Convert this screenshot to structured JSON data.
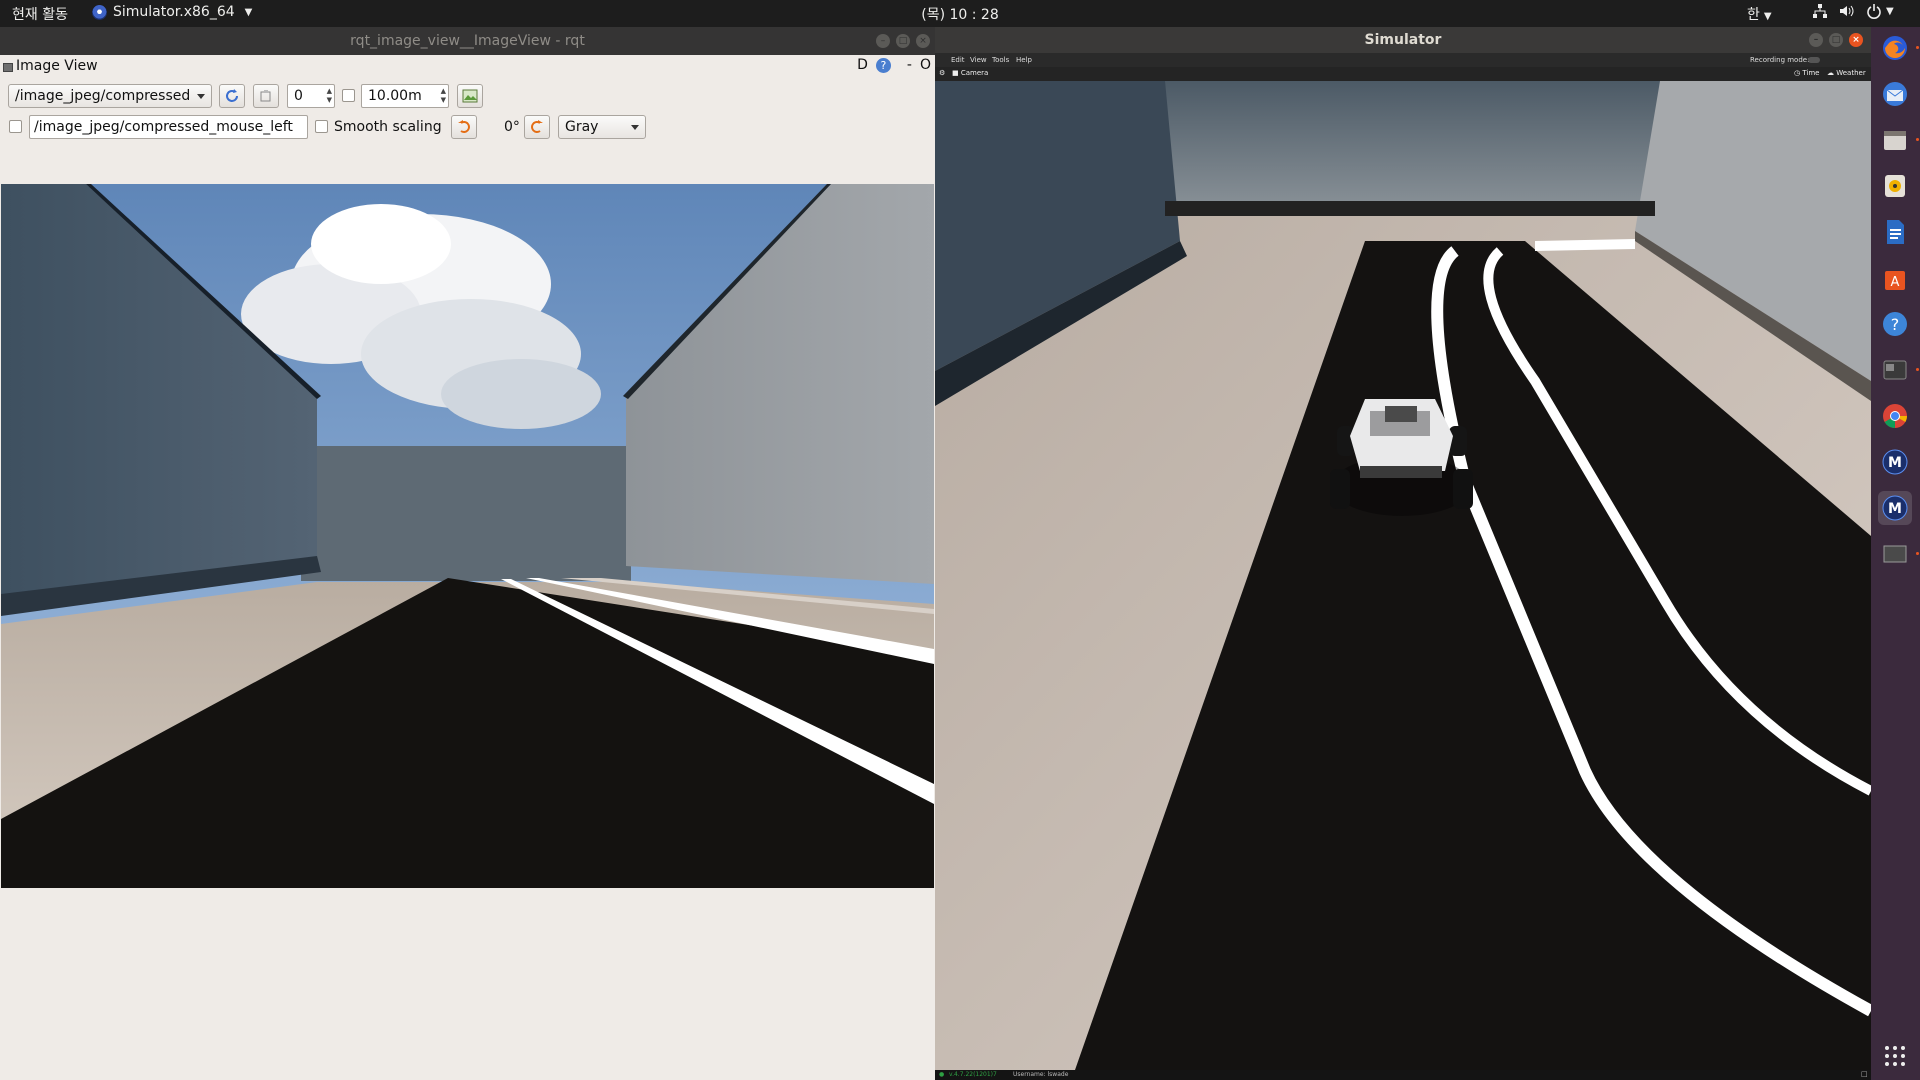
{
  "topbar": {
    "activities": "현재 활동",
    "app_menu": "Simulator.x86_64",
    "clock": "(목) 10 : 28",
    "input_method": "한"
  },
  "rqt": {
    "window_title": "rqt_image_view__ImageView - rqt",
    "plugin_title": "Image View",
    "header_buttons": {
      "d_label": "D",
      "help_label": "?",
      "minus_label": "-",
      "close_label": "O"
    },
    "toolbar": {
      "topic": "/image_jpeg/compressed",
      "frame_value": "0",
      "distance_value": "10.00m",
      "mouse_topic": "/image_jpeg/compressed_mouse_left",
      "smooth_scaling_label": "Smooth scaling",
      "rotation_label": "0°",
      "color_scheme": "Gray"
    }
  },
  "simulator": {
    "window_title": "Simulator",
    "menu": [
      "Edit",
      "View",
      "Tools",
      "Help"
    ],
    "recording_label": "Recording mode:",
    "camera_label": "Camera",
    "time_label": "Time",
    "weather_label": "Weather",
    "version_text": "v.4.7.22(1201)7",
    "username_text": "Username: lswade"
  },
  "dock": {
    "items": [
      "firefox-icon",
      "thunderbird-icon",
      "files-icon",
      "rhythmbox-icon",
      "writer-icon",
      "software-icon",
      "help-icon",
      "terminal-icon",
      "chrome-icon",
      "simulator-icon",
      "simulator-icon-2",
      "window-icon"
    ],
    "apps_grid": "show-applications-icon"
  },
  "colors": {
    "accent": "#e95420",
    "dock_bg": "#3b2a3d",
    "topbar_bg": "#1d1d1d"
  }
}
